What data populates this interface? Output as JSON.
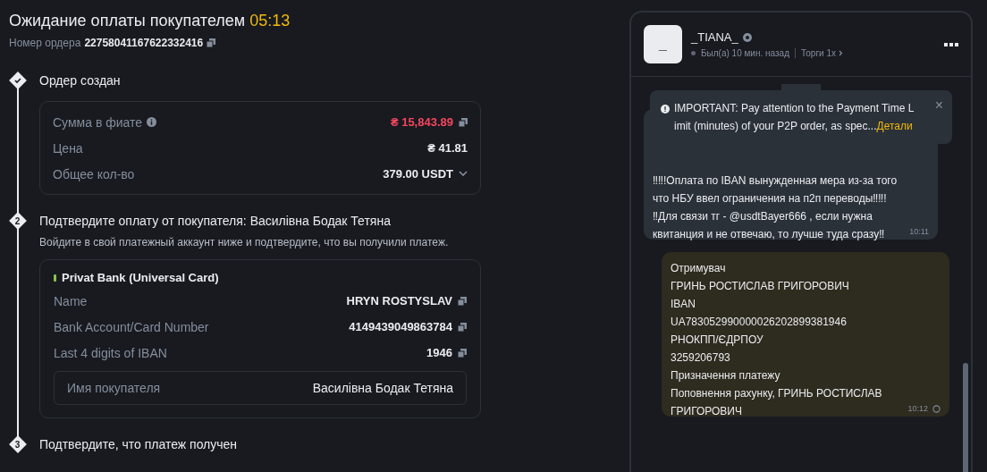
{
  "header": {
    "title": "Ожидание оплаты покупателем",
    "timer": "05:13",
    "order_label": "Номер ордера",
    "order_number": "22758041167622332416"
  },
  "steps": [
    {
      "kind": "done",
      "title": "Ордер создан",
      "summary": [
        {
          "label": "Сумма в фиате",
          "info": true,
          "value": "₴ 15,843.89",
          "accent": true,
          "copy": true,
          "expand": false
        },
        {
          "label": "Цена",
          "info": false,
          "value": "₴ 41.81",
          "accent": false,
          "copy": false,
          "expand": false
        },
        {
          "label": "Общее кол-во",
          "info": false,
          "value": "379.00 USDT",
          "accent": false,
          "copy": false,
          "expand": true
        }
      ]
    },
    {
      "kind": "number",
      "marker": "2",
      "title": "Подтвердите оплату от покупателя: Василівна Бодак Тетяна",
      "hint": "Войдите в свой платежный аккаунт ниже и подтвердите, что вы получили платеж.",
      "bank": {
        "name": "Privat Bank (Universal Card)",
        "color": "#8bc34a",
        "fields": [
          {
            "label": "Name",
            "value": "HRYN ROSTYSLAV"
          },
          {
            "label": "Bank Account/Card Number",
            "value": "4149439049863784"
          },
          {
            "label": "Last 4 digits of IBAN",
            "value": "1946"
          }
        ],
        "buyer_label": "Имя покупателя",
        "buyer_name": "Василівна Бодак Тетяна"
      }
    },
    {
      "kind": "number",
      "marker": "3",
      "title": "Подтвердите, что платеж получен"
    }
  ],
  "chat": {
    "avatar": "_",
    "name": "_TIANA_",
    "status": "Был(а) 10 мин. назад",
    "trades": "Торги 1x",
    "notice": {
      "text": "IMPORTANT: Pay attention to the Payment Time L imit (minutes) of your P2P order, as spec...",
      "link": "Детали",
      "close": "×"
    },
    "messages": [
      {
        "kind": "incoming",
        "paragraphs": [
          [
            "‼‼!Оплата по IBAN вынужденная мера из-за того",
            "что НБУ ввел ограничения на п2п переводы‼‼!"
          ],
          [
            "‼Для связи тг - @usdtBayer666 , если нужна",
            "квитанция и не отвечаю, то лучше туда сразу‼"
          ]
        ],
        "time": "10:11"
      },
      {
        "kind": "outgoing",
        "paragraphs": [
          [
            "Отримувач",
            "ГРИНЬ РОСТИСЛАВ ГРИГОРОВИЧ",
            "IBAN",
            "UA783052990000026202899381946",
            "РНОКПП/ЄДРПОУ",
            "3259206793",
            "Призначення платежу",
            "Поповнення рахунку, ГРИНЬ РОСТИСЛАВ",
            "ГРИГОРОВИЧ"
          ]
        ],
        "time": "10:12"
      }
    ]
  }
}
